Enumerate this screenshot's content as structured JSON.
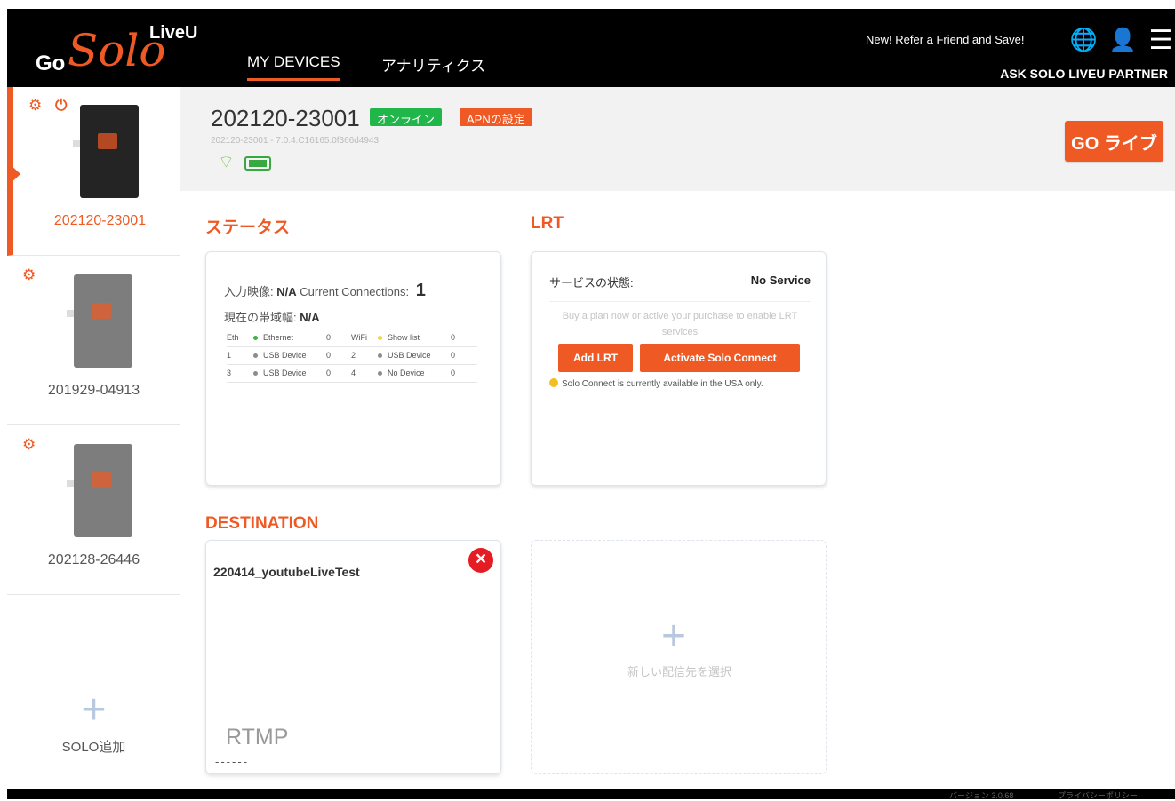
{
  "app": {
    "logo": {
      "go": "Go",
      "solo": "Solo",
      "liveu": "LiveU"
    },
    "nav": [
      {
        "label": "MY DEVICES"
      },
      {
        "label": "アナリティクス"
      }
    ],
    "refer_text": "New! Refer a Friend and Save!",
    "partner_text": "ASK SOLO LIVEU PARTNER",
    "icons": {
      "language": "globe-icon",
      "account": "account-icon",
      "menu": "hamburger-menu-icon"
    }
  },
  "devices": [
    {
      "id": "202120-23001",
      "status_icons": [
        "settings-icon",
        "power-icon"
      ],
      "active": true
    },
    {
      "id": "201929-04913",
      "status_icons": [
        "settings-icon"
      ],
      "active": false
    },
    {
      "id": "202128-26446",
      "status_icons": [
        "settings-icon"
      ],
      "active": false
    }
  ],
  "add_solo": {
    "label": "SOLO追加"
  },
  "selected_device": {
    "title": "202120-23001",
    "online_badge": "オンライン",
    "apn_badge": "APNの設定",
    "subtitle": "202120-23001 - 7.0.4.C16165.0f366d4943",
    "go_live_label": "GO ライブ"
  },
  "status": {
    "section_title": "ステータス",
    "input_label": "入力映像:",
    "input_value": "N/A",
    "connections_label": "Current Connections:",
    "connections_value": "1",
    "bandwidth_label": "現在の帯域幅:",
    "bandwidth_value": "N/A",
    "interfaces": [
      {
        "left_key": "Eth",
        "left_name": "Ethernet",
        "left_value": "0",
        "right_key": "WiFi",
        "right_name": "Show list",
        "right_value": "0"
      },
      {
        "left_key": "1",
        "left_name": "USB Device",
        "left_value": "0",
        "right_key": "2",
        "right_name": "USB Device",
        "right_value": "0"
      },
      {
        "left_key": "3",
        "left_name": "USB Device",
        "left_value": "0",
        "right_key": "4",
        "right_name": "No Device",
        "right_value": "0"
      }
    ]
  },
  "lrt": {
    "section_title": "LRT",
    "service_label": "サービスの状態:",
    "service_value": "No Service",
    "help": "Buy a plan now or active your purchase to enable LRT services",
    "add_button": "Add LRT",
    "activate_button": "Activate Solo Connect",
    "notice": "Solo Connect is currently available in the USA only."
  },
  "destination": {
    "section_title": "DESTINATION",
    "name": "220414_youtubeLiveTest",
    "protocol": "RTMP",
    "dashes": "------",
    "new_destination": "新しい配信先を選択"
  },
  "footer": {
    "version": "バージョン 3.0.68",
    "privacy": "プライバシーポリシー"
  },
  "colors": {
    "accent": "#ef5a24",
    "online": "#21b64a",
    "danger": "#e51c23",
    "topbar": "#000000"
  }
}
